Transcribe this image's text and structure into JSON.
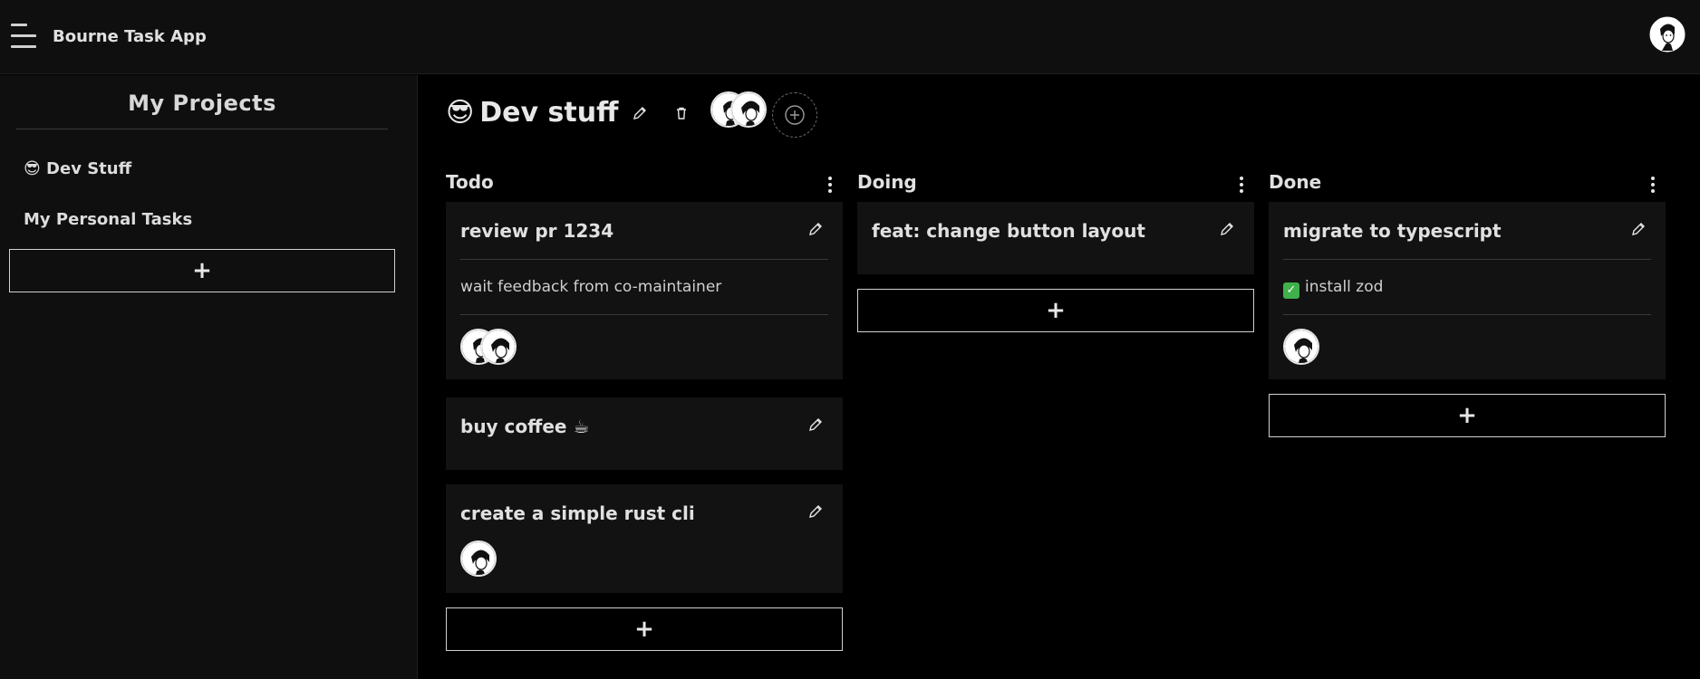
{
  "app": {
    "title": "Bourne Task App"
  },
  "sidebar": {
    "title": "My Projects",
    "items": [
      {
        "emoji": "😎",
        "label": "Dev Stuff"
      },
      {
        "emoji": "",
        "label": "My Personal Tasks"
      }
    ],
    "add_label": "+"
  },
  "project": {
    "emoji": "😎",
    "title": "Dev stuff"
  },
  "columns": [
    {
      "title": "Todo",
      "cards": [
        {
          "title": "review pr 1234",
          "description": "wait feedback from co-maintainer",
          "assignees": 2
        },
        {
          "title": "buy coffee ☕",
          "description": "",
          "assignees": 0
        },
        {
          "title": "create a simple rust cli",
          "description": "",
          "assignees": 1
        }
      ],
      "add_label": "+"
    },
    {
      "title": "Doing",
      "cards": [
        {
          "title": "feat: change button layout",
          "description": "",
          "assignees": 0
        }
      ],
      "add_label": "+"
    },
    {
      "title": "Done",
      "cards": [
        {
          "title": "migrate to typescript",
          "description": "install zod",
          "description_icon": "check-icon",
          "assignees": 1
        }
      ],
      "add_label": "+"
    }
  ],
  "colors": {
    "background": "#000000",
    "panel": "#0f0f0f",
    "card": "#121212",
    "text": "#e0e0e0",
    "check": "#3fb04a"
  }
}
